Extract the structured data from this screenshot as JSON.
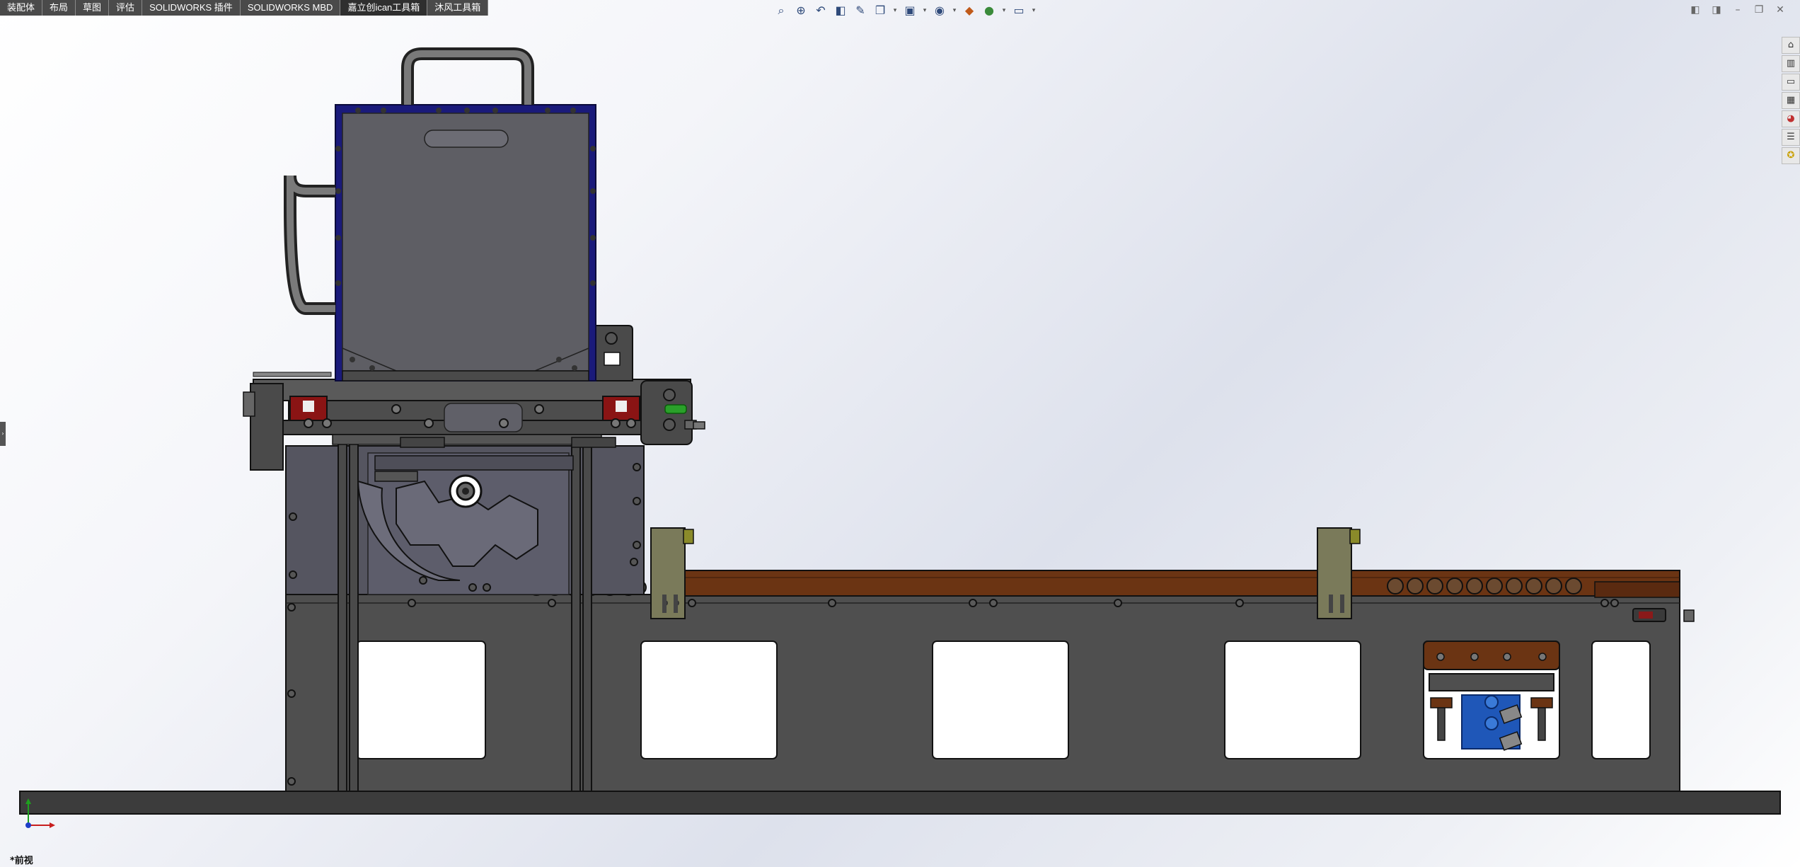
{
  "tabs": [
    {
      "label": "装配体"
    },
    {
      "label": "布局"
    },
    {
      "label": "草图"
    },
    {
      "label": "评估"
    },
    {
      "label": "SOLIDWORKS 插件"
    },
    {
      "label": "SOLIDWORKS MBD"
    },
    {
      "label": "嘉立创ican工具箱"
    },
    {
      "label": "沐风工具箱"
    }
  ],
  "active_tab_index": 6,
  "headsup_icons": [
    "zoom-to-fit-icon",
    "zoom-area-icon",
    "previous-view-icon",
    "section-view-icon",
    "dynamic-annotation-icon",
    "view-orientation-icon",
    "display-style-icon",
    "hide-show-icon",
    "edit-appearance-icon",
    "apply-scene-icon",
    "view-settings-icon"
  ],
  "task_pane_icons": [
    "solidworks-resources-icon",
    "design-library-icon",
    "file-explorer-icon",
    "view-palette-icon",
    "appearances-icon",
    "custom-properties-icon",
    "forum-icon"
  ],
  "view_name": "*前视",
  "colors": {
    "hopper_frame": "#1a1a7a",
    "machine_gray": "#4f4f4f",
    "belt_brown": "#6b3413",
    "cylinder_blue": "#1f57b8",
    "slider_red": "#8a1414",
    "valve_green": "#2aa02a"
  }
}
